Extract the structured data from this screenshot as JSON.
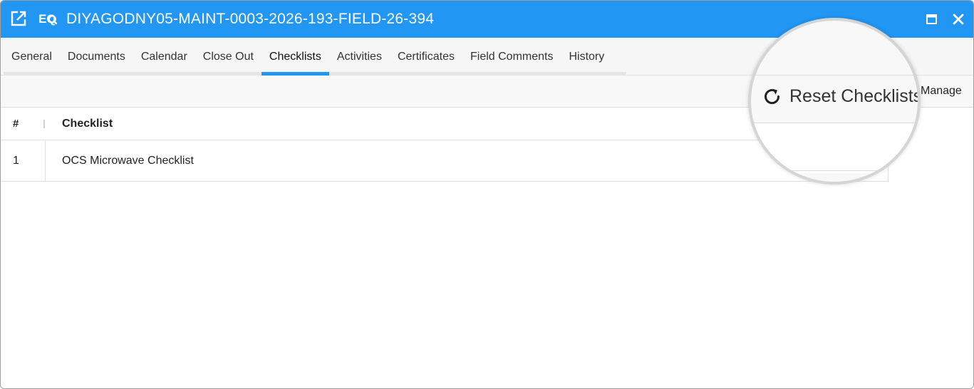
{
  "window": {
    "title": "DIYAGODNY05-MAINT-0003-2026-193-FIELD-26-394",
    "accent_color": "#2196f3",
    "icons": [
      "popout-icon",
      "eq-icon",
      "maximize-icon",
      "close-icon"
    ]
  },
  "tabs": [
    {
      "label": "General",
      "active": false
    },
    {
      "label": "Documents",
      "active": false
    },
    {
      "label": "Calendar",
      "active": false
    },
    {
      "label": "Close Out",
      "active": false
    },
    {
      "label": "Checklists",
      "active": true
    },
    {
      "label": "Activities",
      "active": false
    },
    {
      "label": "Certificates",
      "active": false
    },
    {
      "label": "Field Comments",
      "active": false
    },
    {
      "label": "History",
      "active": false
    }
  ],
  "toolbar": {
    "reset_label": "Reset Checklists",
    "manage_label": "Manage"
  },
  "grid": {
    "columns": [
      "#",
      "Checklist"
    ],
    "rows": [
      {
        "num": "1",
        "name": "OCS Microwave Checklist"
      }
    ]
  }
}
